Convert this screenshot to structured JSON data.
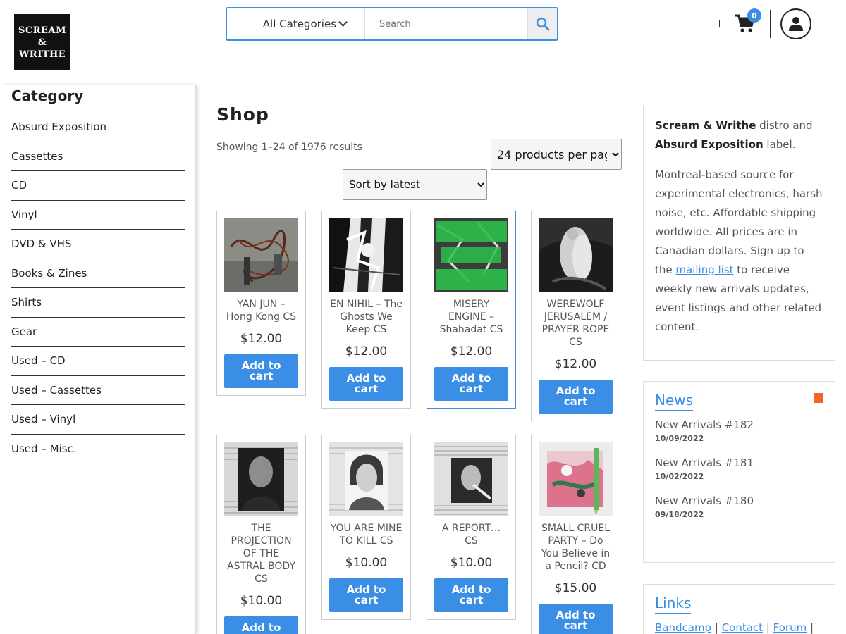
{
  "header": {
    "logo_lines": [
      "SCREAM",
      "&",
      "WRITHE"
    ],
    "category_select": "All Categories",
    "search_placeholder": "Search",
    "cart_count": "0",
    "accent_color": "#3a8ee6"
  },
  "sidebar": {
    "title": "Category",
    "items": [
      "Absurd Exposition",
      "Cassettes",
      "CD",
      "Vinyl",
      "DVD & VHS",
      "Books & Zines",
      "Shirts",
      "Gear",
      "Used – CD",
      "Used – Cassettes",
      "Used – Vinyl",
      "Used – Misc."
    ]
  },
  "main": {
    "title": "Shop",
    "result_count": "Showing 1–24 of 1976 results",
    "per_page": "24 products per page",
    "sort_by": "Sort by latest",
    "add_to_cart_line1": "Add to",
    "add_to_cart_line2": "cart",
    "products": [
      {
        "name": "YAN JUN – Hong Kong CS",
        "price": "$12.00",
        "image": "tangled-wires-photo"
      },
      {
        "name": "EN NIHIL – The Ghosts We Keep CS",
        "price": "$12.00",
        "image": "bw-forest-collage"
      },
      {
        "name": "MISERY ENGINE – Shahadat CS",
        "price": "$12.00",
        "image": "green-text-cover"
      },
      {
        "name": "WEREWOLF JERUSALEM / PRAYER ROPE CS",
        "price": "$12.00",
        "image": "engraving-figures"
      },
      {
        "name": "THE PROJECTION OF THE ASTRAL BODY CS",
        "price": "$10.00",
        "image": "bw-man-portrait"
      },
      {
        "name": "YOU ARE MINE TO KILL CS",
        "price": "$10.00",
        "image": "bw-woman-portrait"
      },
      {
        "name": "A REPORT… CS",
        "price": "$10.00",
        "image": "bw-newspaper-figure"
      },
      {
        "name": "SMALL CRUEL PARTY – Do You Believe in a Pencil? CD",
        "price": "$15.00",
        "image": "colorful-abstract-pencil"
      }
    ]
  },
  "about": {
    "brand": "Scream & Writhe",
    "text1": " distro and ",
    "label": "Absurd Exposition",
    "text2": " label.",
    "para2_pre": "Montreal-based source for experimental electronics, harsh noise, etc. Affordable shipping worldwide. All prices are in Canadian dollars. Sign up to the ",
    "mailing_link": "mailing list",
    "para2_post": " to receive weekly new arrivals updates, event listings and other related content."
  },
  "news": {
    "title": "News",
    "items": [
      {
        "title": "New Arrivals #182",
        "date": "10/09/2022"
      },
      {
        "title": "New Arrivals #181",
        "date": "10/02/2022"
      },
      {
        "title": "New Arrivals #180",
        "date": "09/18/2022"
      }
    ]
  },
  "links": {
    "title": "Links",
    "items": [
      "Bandcamp",
      "Contact",
      "Forum"
    ],
    "separator": " | "
  }
}
